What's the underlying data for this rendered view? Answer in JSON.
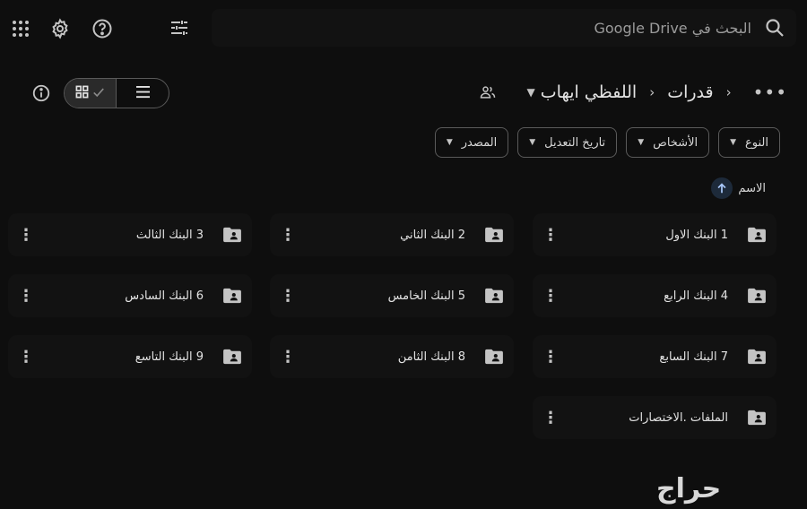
{
  "search": {
    "placeholder": "البحث في Google Drive"
  },
  "toolbar_icons": [
    "apps-grid-icon",
    "settings-gear-icon",
    "help-icon",
    "search-options-icon",
    "search-icon"
  ],
  "view": {
    "current": "grid",
    "info_icon": "info-icon",
    "grid_icon": "grid-icon",
    "check_icon": "check-icon",
    "list_icon": "list-icon"
  },
  "breadcrumb": {
    "more": "•••",
    "parent": "قدرات",
    "current": "اللفظي ايهاب",
    "current_dropdown": "▼",
    "shared_icon": "people-icon"
  },
  "filters": [
    {
      "label": "النوع"
    },
    {
      "label": "الأشخاص"
    },
    {
      "label": "تاريخ التعديل"
    },
    {
      "label": "المصدر"
    }
  ],
  "sort": {
    "label": "الاسم",
    "direction": "ascending"
  },
  "folders": [
    {
      "name": "1 البنك الاول"
    },
    {
      "name": "2 البنك الثاني"
    },
    {
      "name": "3 البنك الثالث"
    },
    {
      "name": "4 البنك الرابع"
    },
    {
      "name": "5 البنك الخامس"
    },
    {
      "name": "6 البنك السادس"
    },
    {
      "name": "7 البنك السابع"
    },
    {
      "name": "8 البنك الثامن"
    },
    {
      "name": "9 البنك التاسع"
    },
    {
      "name": "الملفات .الاختصارات"
    }
  ],
  "watermark": "حراج"
}
